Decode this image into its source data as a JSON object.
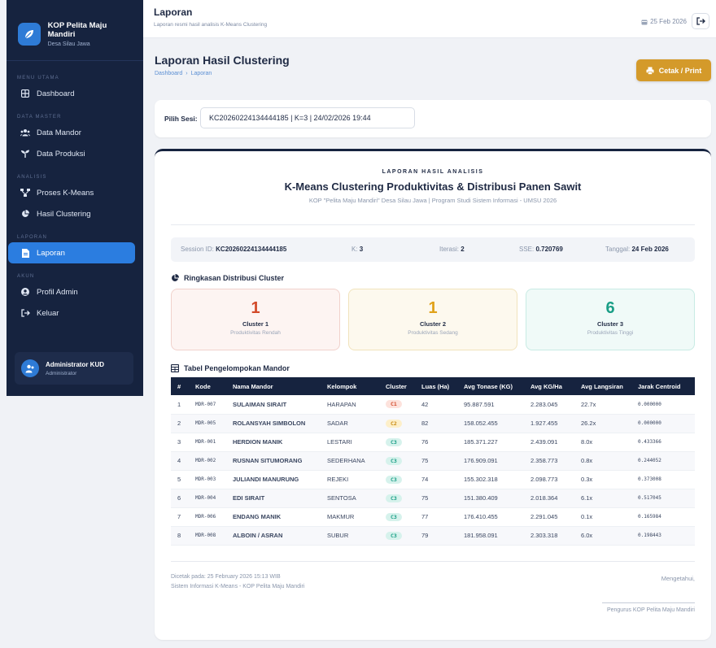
{
  "sidebar": {
    "brand_name": "KOP Pelita Maju Mandiri",
    "brand_sub": "Desa Silau Jawa",
    "sections": {
      "menu_utama": "MENU UTAMA",
      "data_master": "DATA MASTER",
      "analisis": "ANALISIS",
      "laporan": "LAPORAN",
      "akun": "AKUN"
    },
    "items": {
      "dashboard": "Dashboard",
      "data_mandor": "Data Mandor",
      "data_produksi": "Data Produksi",
      "proses_kmeans": "Proses K-Means",
      "hasil_clustering": "Hasil Clustering",
      "laporan": "Laporan",
      "profil_admin": "Profil Admin",
      "keluar": "Keluar"
    },
    "user": {
      "name": "Administrator KUD",
      "role": "Administrator"
    }
  },
  "topbar": {
    "title": "Laporan",
    "subtitle": "Laporan resmi hasil analisis K-Means Clustering",
    "date": "25 Feb 2026"
  },
  "page": {
    "title": "Laporan Hasil Clustering",
    "breadcrumb": [
      "Dashboard",
      "›",
      "Laporan"
    ],
    "print_label": "Cetak / Print"
  },
  "session": {
    "label": "Pilih Sesi:",
    "value": "KC20260224134444185 | K=3 | 24/02/2026 19:44"
  },
  "report": {
    "kicker": "LAPORAN HASIL ANALISIS",
    "title": "K-Means Clustering Produktivitas & Distribusi Panen Sawit",
    "subtitle": "KOP \"Pelita Maju Mandiri\" Desa Silau Jawa | Program Studi Sistem Informasi - UMSU 2026",
    "meta": {
      "session_label": "Session ID:",
      "session_value": "KC20260224134444185",
      "k_label": "K:",
      "k_value": "3",
      "iter_label": "Iterasi:",
      "iter_value": "2",
      "sse_label": "SSE:",
      "sse_value": "0.720769",
      "date_label": "Tanggal:",
      "date_value": "24 Feb 2026"
    },
    "summary_title": "Ringkasan Distribusi Cluster",
    "clusters": [
      {
        "count": "1",
        "name": "Cluster 1",
        "desc": "Produktivitas Rendah",
        "color": "#d24a2a"
      },
      {
        "count": "1",
        "name": "Cluster 2",
        "desc": "Produktivitas Sedang",
        "color": "#e0a21a"
      },
      {
        "count": "6",
        "name": "Cluster 3",
        "desc": "Produktivitas Tinggi",
        "color": "#1a9e86"
      }
    ],
    "table_title": "Tabel Pengelompokan Mandor",
    "columns": [
      "#",
      "Kode",
      "Nama Mandor",
      "Kelompok",
      "Cluster",
      "Luas (Ha)",
      "Avg Tonase (KG)",
      "Avg KG/Ha",
      "Avg Langsiran",
      "Jarak Centroid"
    ],
    "rows": [
      {
        "no": "1",
        "kode": "MDR-007",
        "nama": "SULAIMAN SIRAIT",
        "kelompok": "HARAPAN",
        "cluster": "C1",
        "luas": "42",
        "tonase": "95.887.591",
        "kgha": "2.283.045",
        "langsiran": "22.7x",
        "jarak": "0.000000"
      },
      {
        "no": "2",
        "kode": "MDR-005",
        "nama": "ROLANSYAH SIMBOLON",
        "kelompok": "SADAR",
        "cluster": "C2",
        "luas": "82",
        "tonase": "158.052.455",
        "kgha": "1.927.455",
        "langsiran": "26.2x",
        "jarak": "0.000000"
      },
      {
        "no": "3",
        "kode": "MDR-001",
        "nama": "HERDION MANIK",
        "kelompok": "LESTARI",
        "cluster": "C3",
        "luas": "76",
        "tonase": "185.371.227",
        "kgha": "2.439.091",
        "langsiran": "8.0x",
        "jarak": "0.433366"
      },
      {
        "no": "4",
        "kode": "MDR-002",
        "nama": "RUSNAN SITUMORANG",
        "kelompok": "SEDERHANA",
        "cluster": "C3",
        "luas": "75",
        "tonase": "176.909.091",
        "kgha": "2.358.773",
        "langsiran": "0.8x",
        "jarak": "0.244052"
      },
      {
        "no": "5",
        "kode": "MDR-003",
        "nama": "JULIANDI MANURUNG",
        "kelompok": "REJEKI",
        "cluster": "C3",
        "luas": "74",
        "tonase": "155.302.318",
        "kgha": "2.098.773",
        "langsiran": "0.3x",
        "jarak": "0.373008"
      },
      {
        "no": "6",
        "kode": "MDR-004",
        "nama": "EDI SIRAIT",
        "kelompok": "SENTOSA",
        "cluster": "C3",
        "luas": "75",
        "tonase": "151.380.409",
        "kgha": "2.018.364",
        "langsiran": "6.1x",
        "jarak": "0.517045"
      },
      {
        "no": "7",
        "kode": "MDR-006",
        "nama": "ENDANG MANIK",
        "kelompok": "MAKMUR",
        "cluster": "C3",
        "luas": "77",
        "tonase": "176.410.455",
        "kgha": "2.291.045",
        "langsiran": "0.1x",
        "jarak": "0.165984"
      },
      {
        "no": "8",
        "kode": "MDR-008",
        "nama": "ALBOIN / ASRAN",
        "kelompok": "SUBUR",
        "cluster": "C3",
        "luas": "79",
        "tonase": "181.958.091",
        "kgha": "2.303.318",
        "langsiran": "6.0x",
        "jarak": "0.198443"
      }
    ],
    "footer": {
      "printed": "Dicetak pada: 25 February 2026 15:13 WIB",
      "system": "Sistem Informasi K-Means - KOP Pelita Maju Mandiri",
      "acknowledged": "Mengetahui,",
      "signatory": "Pengurus KOP Pelita Maju Mandiri"
    }
  }
}
